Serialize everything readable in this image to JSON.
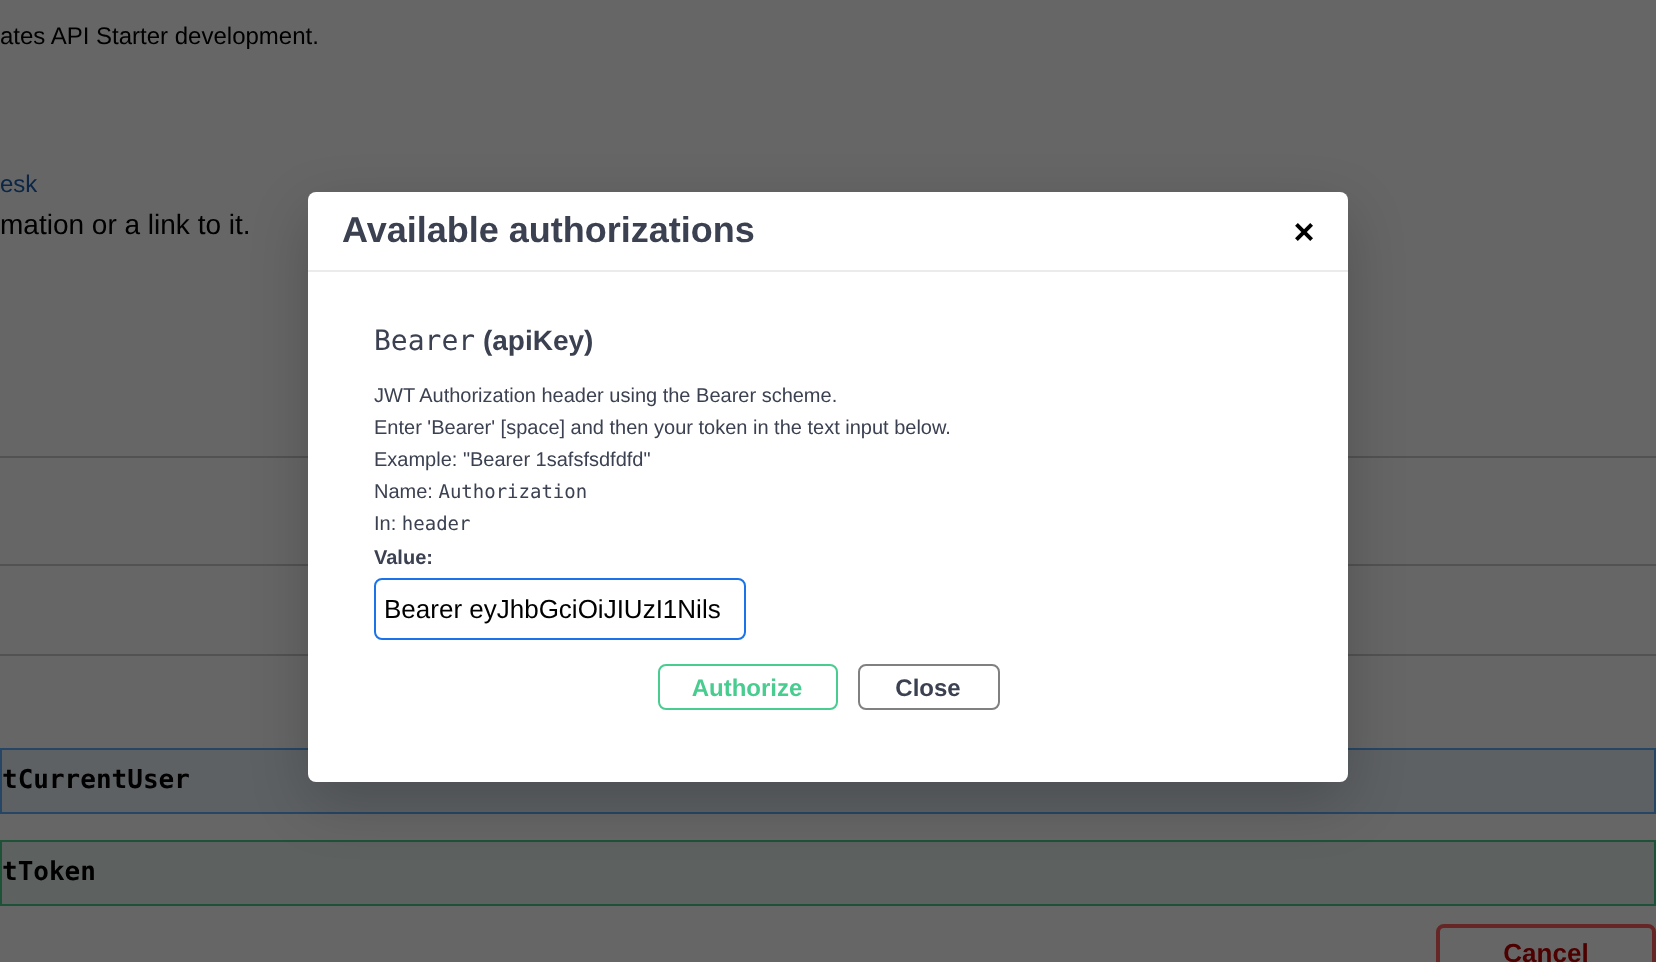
{
  "page": {
    "description": "ates API Starter development.",
    "link": "esk",
    "contact_text": "mation or a link to it.",
    "operations": [
      {
        "kind": "plain"
      },
      {
        "kind": "plain"
      },
      {
        "kind": "plain"
      },
      {
        "kind": "get",
        "label": "tCurrentUser"
      },
      {
        "kind": "post",
        "label": "tToken"
      }
    ],
    "cancel_button": "Cancel"
  },
  "dialog": {
    "title": "Available authorizations",
    "close": "×",
    "scheme": {
      "name": "Bearer",
      "type": "(apiKey)"
    },
    "description": [
      "JWT Authorization header using the Bearer scheme.",
      "Enter 'Bearer' [space] and then your token in the text input below.",
      "Example: \"Bearer 1safsfsdfdfd\""
    ],
    "fields": [
      {
        "label": "Name:",
        "value": "Authorization"
      },
      {
        "label": "In:",
        "value": "header"
      }
    ],
    "value_label": "Value:",
    "value": "Bearer eyJhbGciOiJIUzI1Nils",
    "buttons": [
      {
        "kind": "authorize",
        "label": "Authorize"
      },
      {
        "kind": "close",
        "label": "Close"
      }
    ]
  }
}
